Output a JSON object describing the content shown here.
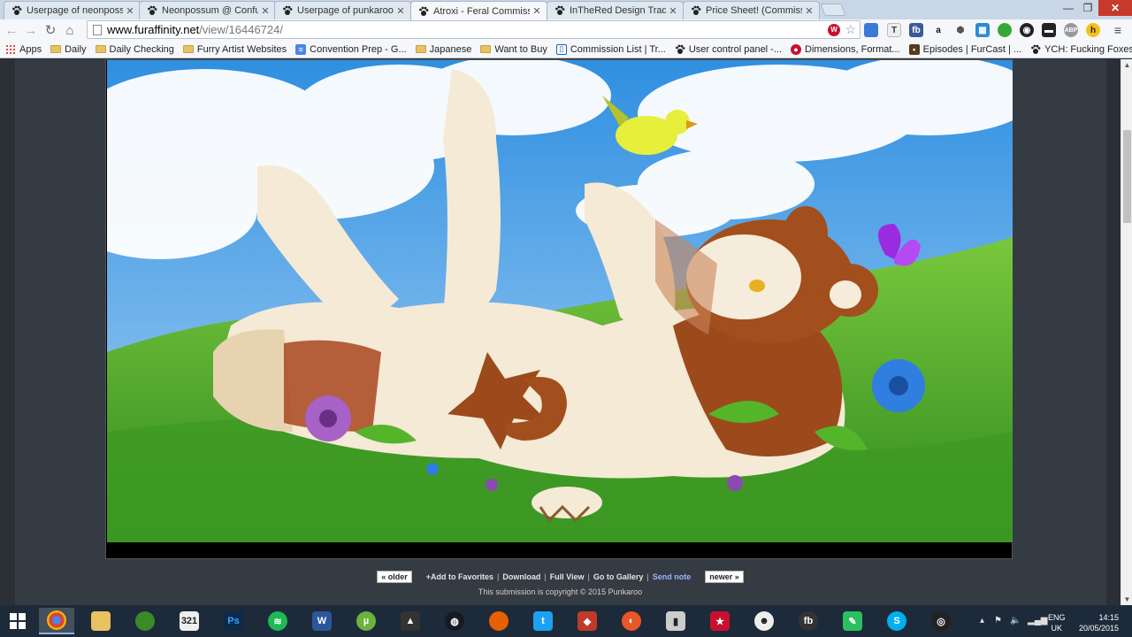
{
  "tabs": [
    {
      "title": "Userpage of neonpossum"
    },
    {
      "title": "Neonpossum @ Confuzzle"
    },
    {
      "title": "Userpage of punkaroo -- F"
    },
    {
      "title": "Atroxi - Feral Commission"
    },
    {
      "title": "InTheRed Design Trade by"
    },
    {
      "title": "Price Sheet! (Commission"
    }
  ],
  "url": {
    "host": "www.furaffinity.net",
    "path": "/view/16446724/"
  },
  "bookmarks": [
    {
      "label": "Apps"
    },
    {
      "label": "Daily"
    },
    {
      "label": "Daily Checking"
    },
    {
      "label": "Furry Artist Websites"
    },
    {
      "label": "Convention Prep - G..."
    },
    {
      "label": "Japanese"
    },
    {
      "label": "Want to Buy"
    },
    {
      "label": "Commission List | Tr..."
    },
    {
      "label": "User control panel -..."
    },
    {
      "label": "Dimensions, Format..."
    },
    {
      "label": "Episodes | FurCast | ..."
    },
    {
      "label": "YCH: Fucking Foxes ..."
    }
  ],
  "actions": {
    "older": "« older",
    "add_favorites": "+Add to Favorites",
    "download": "Download",
    "full_view": "Full View",
    "go_to_gallery": "Go to Gallery",
    "send_note": "Send note",
    "newer": "newer »"
  },
  "copyright": "This submission is copyright © 2015 Punkaroo",
  "tray": {
    "lang1": "ENG",
    "lang2": "UK",
    "time": "14:15",
    "date": "20/05/2015"
  },
  "colors": {
    "accent": "#9bb3ff",
    "page_bg": "#2b3037",
    "taskbar": "#1d2a3a"
  }
}
